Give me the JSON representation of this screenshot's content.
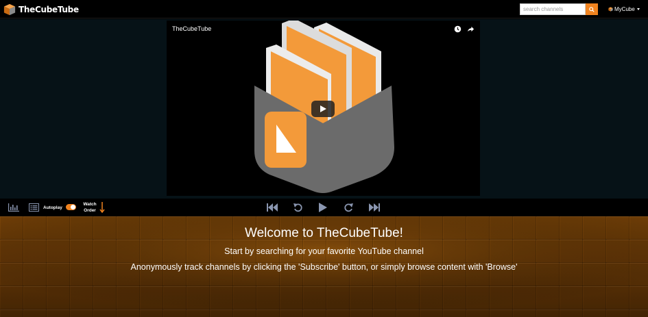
{
  "navbar": {
    "brand": "TheCubeTube",
    "search_placeholder": "search channels",
    "user_menu_label": "MyCube",
    "accent_color": "#f0831f"
  },
  "player": {
    "video_title": "TheCubeTube",
    "icons": [
      "watch-later-icon",
      "share-icon",
      "play-icon"
    ]
  },
  "controls": {
    "autoplay_label": "Autoplay",
    "autoplay_on": true,
    "watch_order_line1": "Watch",
    "watch_order_line2": "Order",
    "icons": [
      "stats-icon",
      "list-icon",
      "arrow-down-icon",
      "skip-back-icon",
      "replay-icon",
      "play-icon",
      "redo-icon",
      "skip-forward-icon"
    ]
  },
  "welcome": {
    "title": "Welcome to TheCubeTube!",
    "line1": "Start by searching for your favorite YouTube channel",
    "line2": "Anonymously track channels by clicking the 'Subscribe' button, or simply browse content with 'Browse'"
  }
}
